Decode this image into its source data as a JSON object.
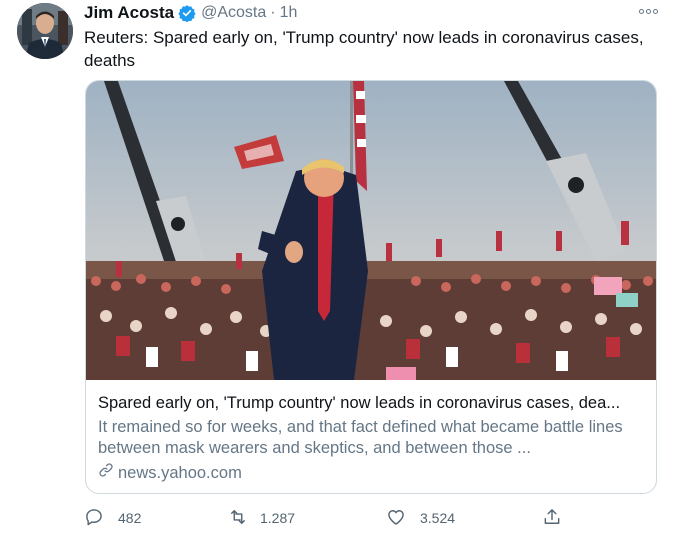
{
  "tweet": {
    "author_name": "Jim Acosta",
    "handle": "@Acosta",
    "separator": "·",
    "time": "1h",
    "text": "Reuters: Spared early on, 'Trump country' now leads in coronavirus cases, deaths",
    "verified_icon": "verified-badge-icon",
    "more_icon": "more-options-icon"
  },
  "card": {
    "title": "Spared early on, 'Trump country' now leads in coronavirus cases, dea...",
    "description": "It remained so for weeks, and that fact defined what became battle lines between mask wearers and skeptics, and between those ...",
    "domain": "news.yahoo.com",
    "link_icon": "link-icon"
  },
  "actions": {
    "reply_count": "482",
    "retweet_count": "1.287",
    "like_count": "3.524",
    "icons": [
      "reply-icon",
      "retweet-icon",
      "like-icon",
      "share-icon"
    ]
  },
  "colors": {
    "text": "#0f1419",
    "secondary": "#657786",
    "verified": "#1d9bf0",
    "border": "#cfd9de"
  }
}
